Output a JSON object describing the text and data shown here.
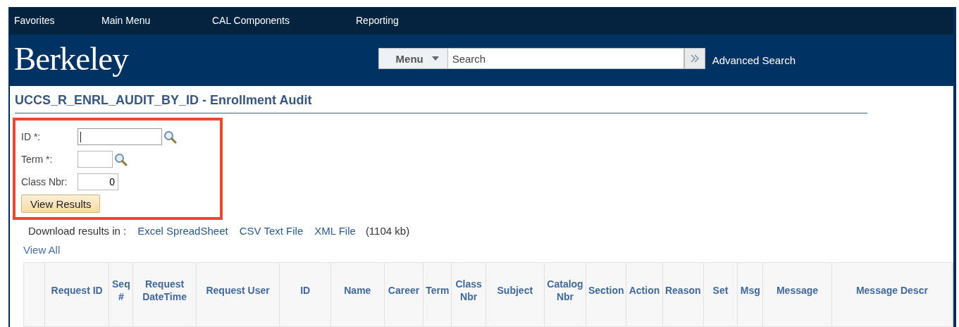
{
  "nav": {
    "items": [
      {
        "label": "Favorites"
      },
      {
        "label": "Main Menu"
      },
      {
        "label": "CAL Components"
      },
      {
        "label": "Reporting"
      }
    ]
  },
  "branding": {
    "logo": "Berkeley",
    "menu_button": "Menu",
    "search": {
      "placeholder": "Search"
    },
    "advanced_search": "Advanced Search"
  },
  "page": {
    "title": "UCCS_R_ENRL_AUDIT_BY_ID - Enrollment Audit"
  },
  "form": {
    "highlighted": true,
    "fields": [
      {
        "label": "ID *:",
        "focused": true,
        "lookup": true
      },
      {
        "label": "Term *:",
        "focused": false,
        "lookup": true
      },
      {
        "label": "Class Nbr:",
        "value": "0",
        "focused": false,
        "lookup": false
      }
    ],
    "button": "View Results"
  },
  "download": {
    "label": "Download results in :",
    "links": [
      "Excel SpreadSheet",
      "CSV Text File",
      "XML File"
    ],
    "size": "(1104 kb)"
  },
  "view_all": "View All",
  "table": {
    "columns": [
      {},
      {
        "label": "Request ID"
      },
      {
        "label": "Seq #"
      },
      {
        "label": "Request DateTime"
      },
      {
        "label": "Request User"
      },
      {
        "label": "ID"
      },
      {
        "label": "Name"
      },
      {
        "label": "Career"
      },
      {
        "label": "Term"
      },
      {
        "label": "Class Nbr"
      },
      {
        "label": "Subject"
      },
      {
        "label": "Catalog Nbr"
      },
      {
        "label": "Section"
      },
      {
        "label": "Action"
      },
      {
        "label": "Reason"
      },
      {
        "label": "Set"
      },
      {
        "label": "Msg"
      },
      {
        "label": "Message"
      },
      {
        "label": "Message Descr"
      }
    ]
  }
}
